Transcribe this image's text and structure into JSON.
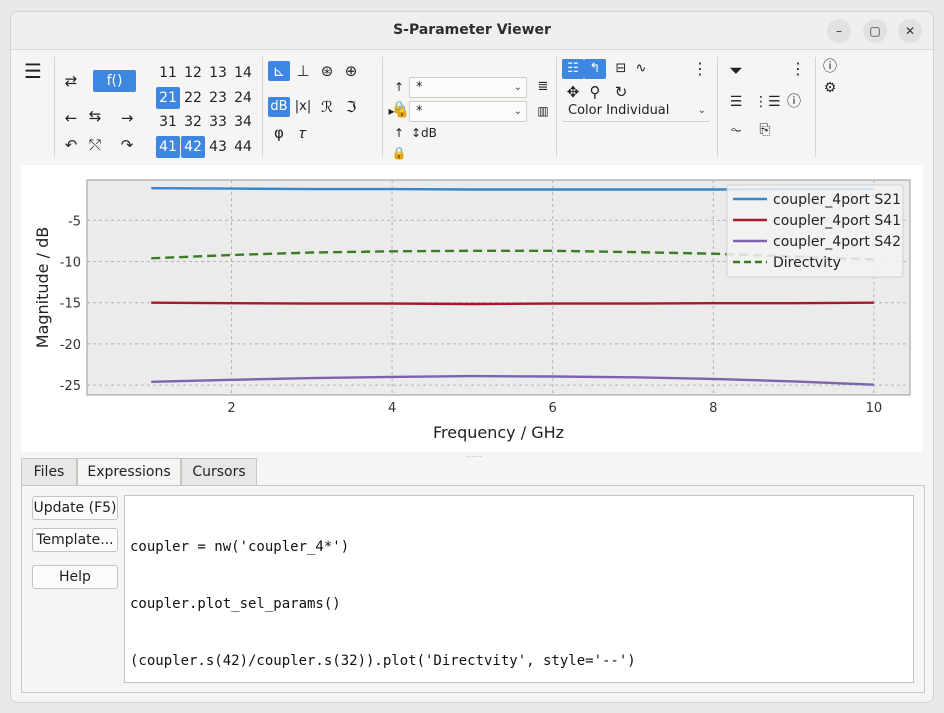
{
  "window": {
    "title": "S-Parameter Viewer",
    "minimize": "–",
    "maximize": "▢",
    "close": "✕"
  },
  "toolbar": {
    "menu_icon": "☰",
    "func_button": "f()",
    "param_grid": [
      [
        "11",
        "12",
        "13",
        "14"
      ],
      [
        "21",
        "22",
        "23",
        "24"
      ],
      [
        "31",
        "32",
        "33",
        "34"
      ],
      [
        "41",
        "42",
        "43",
        "44"
      ]
    ],
    "selected_params": [
      "21",
      "41",
      "42"
    ],
    "unit_db": "dB",
    "unit_abs": "|x|",
    "unit_real": "ℛ",
    "unit_imag": "ℑ",
    "unit_phase": "φ",
    "unit_tau": "𝜏",
    "filter_combo_1": "*",
    "filter_combo_2": "*",
    "color_mode": "Color Individual"
  },
  "chart_data": {
    "type": "line",
    "xlabel": "Frequency / GHz",
    "ylabel": "Magnitude / dB",
    "xlim": [
      0.2,
      10.45
    ],
    "ylim": [
      -26.2,
      -0.1
    ],
    "xticks": [
      2,
      4,
      6,
      8,
      10
    ],
    "yticks": [
      -5,
      -10,
      -15,
      -20,
      -25
    ],
    "grid": true,
    "legend_position": "top-right",
    "series": [
      {
        "name": "coupler_4port S21",
        "color": "#3a86c4",
        "dash": "solid",
        "x": [
          1,
          2,
          3,
          4,
          5,
          6,
          7,
          8,
          9,
          10
        ],
        "y": [
          -1.1,
          -1.15,
          -1.2,
          -1.2,
          -1.25,
          -1.25,
          -1.25,
          -1.25,
          -1.2,
          -1.2
        ]
      },
      {
        "name": "coupler_4port S41",
        "color": "#a8182a",
        "dash": "solid",
        "x": [
          1,
          2,
          3,
          4,
          5,
          6,
          7,
          8,
          9,
          10
        ],
        "y": [
          -15.0,
          -15.05,
          -15.1,
          -15.1,
          -15.15,
          -15.1,
          -15.1,
          -15.05,
          -15.05,
          -15.0
        ]
      },
      {
        "name": "coupler_4port S42",
        "color": "#7a64ad",
        "dash": "solid",
        "x": [
          1,
          2,
          3,
          4,
          5,
          6,
          7,
          8,
          9,
          10
        ],
        "y": [
          -24.6,
          -24.35,
          -24.15,
          -24.0,
          -23.9,
          -23.95,
          -24.05,
          -24.25,
          -24.55,
          -24.95
        ]
      },
      {
        "name": "Directvity",
        "color": "#3c7d23",
        "dash": "dashed",
        "x": [
          1,
          2,
          3,
          4,
          5,
          6,
          7,
          8,
          9,
          10
        ],
        "y": [
          -9.6,
          -9.2,
          -8.9,
          -8.75,
          -8.7,
          -8.7,
          -8.85,
          -9.05,
          -9.4,
          -9.75
        ]
      }
    ]
  },
  "tabs": [
    {
      "label": "Files"
    },
    {
      "label": "Expressions"
    },
    {
      "label": "Cursors"
    }
  ],
  "panel": {
    "update_button": "Update (F5)",
    "template_button": "Template...",
    "help_button": "Help",
    "code_lines": [
      "coupler = nw('coupler_4*')",
      "coupler.plot_sel_params()",
      "(coupler.s(42)/coupler.s(32)).plot('Directvity', style='--')"
    ]
  }
}
